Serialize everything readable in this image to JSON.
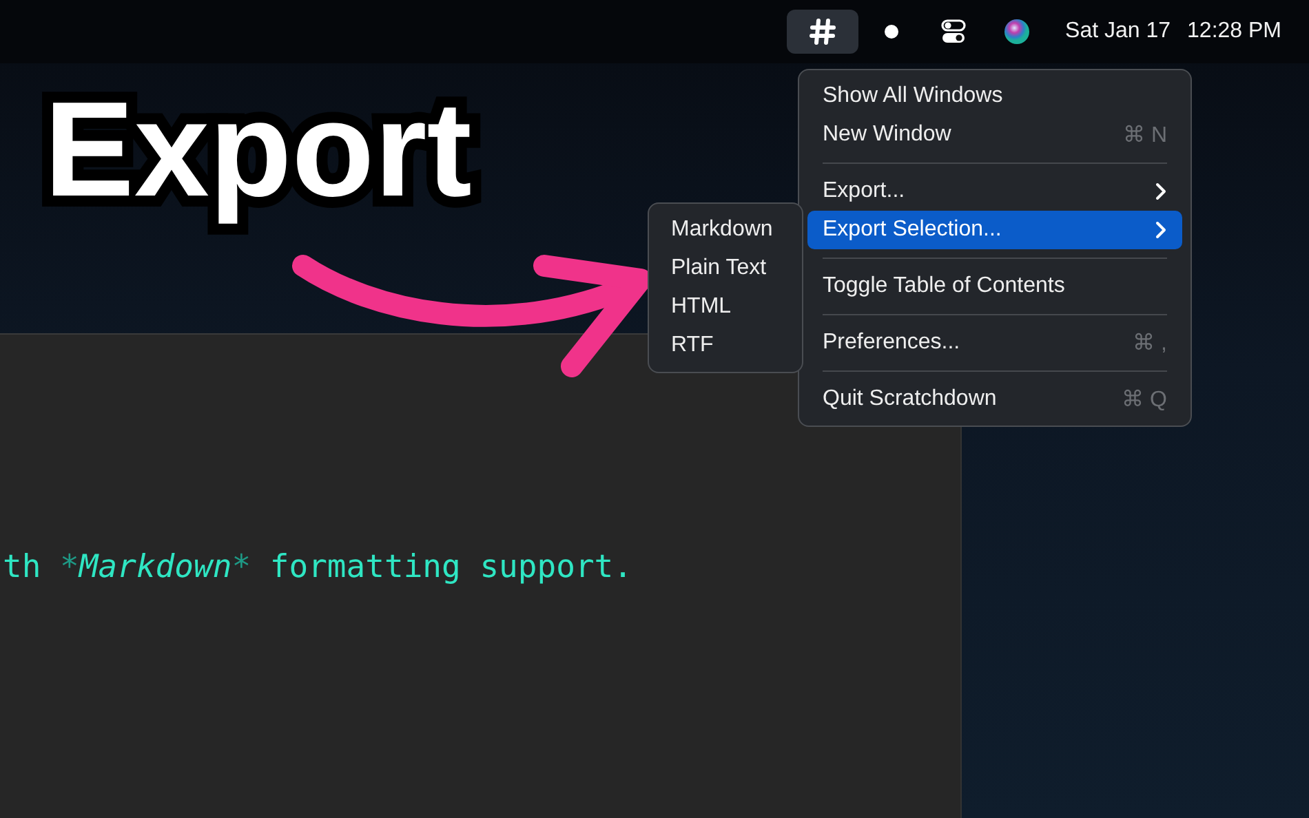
{
  "menu_bar": {
    "items": [
      {
        "kind": "hash",
        "selected": true
      },
      {
        "kind": "dot",
        "selected": false
      },
      {
        "kind": "toggles",
        "selected": false
      },
      {
        "kind": "orb",
        "selected": false
      }
    ],
    "date": "Sat Jan 17",
    "time": "12:28 PM"
  },
  "caption": {
    "title": "Export"
  },
  "editor": {
    "line": [
      {
        "kind": "plain",
        "text": "th "
      },
      {
        "kind": "marker",
        "text": "*"
      },
      {
        "kind": "italic",
        "text": "Markdown"
      },
      {
        "kind": "marker",
        "text": "*"
      },
      {
        "kind": "plain",
        "text": " formatting support."
      }
    ]
  },
  "menu": {
    "items": [
      {
        "kind": "item",
        "label": "Show All Windows",
        "selected": false,
        "submenu": false
      },
      {
        "kind": "item",
        "label": "New Window",
        "shortcut": "⌘ N",
        "selected": false,
        "submenu": false
      },
      {
        "kind": "separator"
      },
      {
        "kind": "item",
        "label": "Export...",
        "selected": false,
        "submenu": true
      },
      {
        "kind": "item",
        "label": "Export Selection...",
        "selected": true,
        "submenu": true
      },
      {
        "kind": "separator"
      },
      {
        "kind": "item",
        "label": "Toggle Table of Contents",
        "selected": false,
        "submenu": false
      },
      {
        "kind": "separator"
      },
      {
        "kind": "item",
        "label": "Preferences...",
        "shortcut": "⌘ ,",
        "selected": false,
        "submenu": false
      },
      {
        "kind": "separator"
      },
      {
        "kind": "item",
        "label": "Quit Scratchdown",
        "shortcut": "⌘ Q",
        "selected": false,
        "submenu": false
      }
    ]
  },
  "submenu": {
    "items": [
      "Markdown",
      "Plain Text",
      "HTML",
      "RTF"
    ]
  }
}
